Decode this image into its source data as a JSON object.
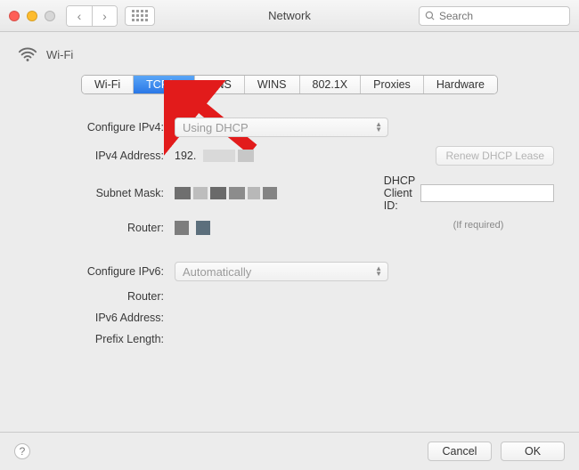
{
  "window": {
    "title": "Network"
  },
  "toolbar": {
    "search_placeholder": "Search"
  },
  "header": {
    "interface": "Wi-Fi"
  },
  "tabs": [
    {
      "label": "Wi-Fi",
      "active": false
    },
    {
      "label": "TCP/IP",
      "active": true
    },
    {
      "label": "DNS",
      "active": false
    },
    {
      "label": "WINS",
      "active": false
    },
    {
      "label": "802.1X",
      "active": false
    },
    {
      "label": "Proxies",
      "active": false
    },
    {
      "label": "Hardware",
      "active": false
    }
  ],
  "ipv4": {
    "configure_label": "Configure IPv4:",
    "configure_value": "Using DHCP",
    "address_label": "IPv4 Address:",
    "address_value": "192.",
    "subnet_label": "Subnet Mask:",
    "router_label": "Router:",
    "renew_btn": "Renew DHCP Lease",
    "dhcp_client_label": "DHCP Client ID:",
    "required_hint": "(If required)"
  },
  "ipv6": {
    "configure_label": "Configure IPv6:",
    "configure_value": "Automatically",
    "router_label": "Router:",
    "address_label": "IPv6 Address:",
    "prefix_label": "Prefix Length:"
  },
  "footer": {
    "cancel": "Cancel",
    "ok": "OK"
  }
}
